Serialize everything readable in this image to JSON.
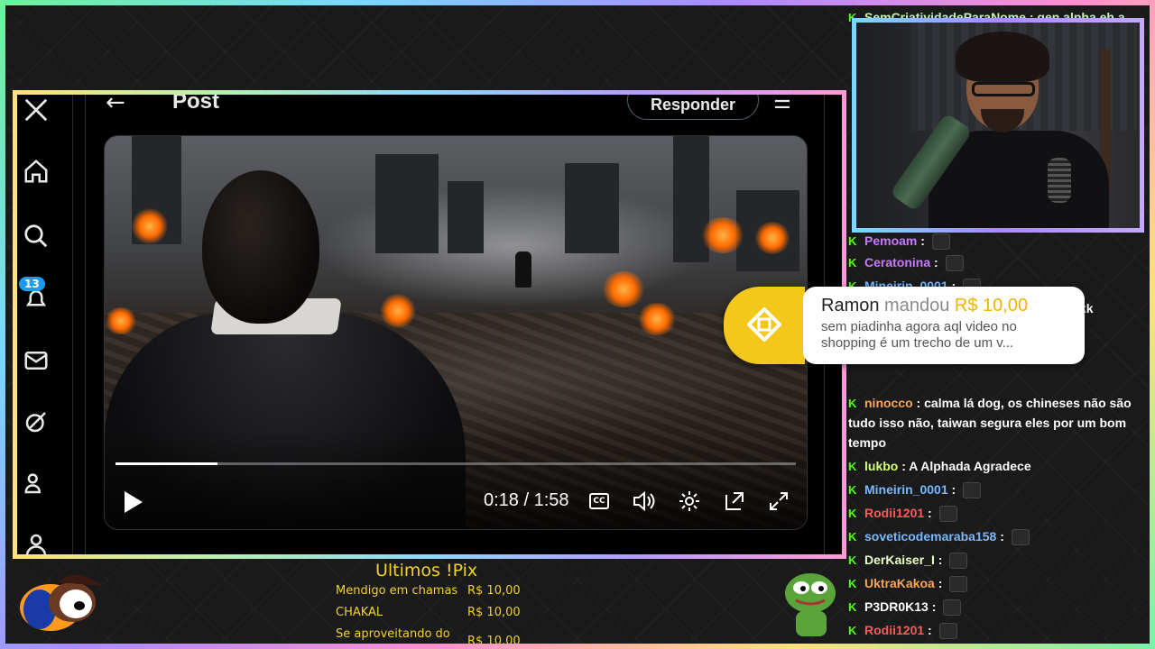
{
  "post_view": {
    "title": "Post",
    "reply_label": "Responder",
    "notification_count": "13"
  },
  "video": {
    "time": "0:18 / 1:58",
    "progress": 0.15,
    "cc_label": "CC"
  },
  "donation": {
    "name": "Ramon",
    "verb": "mandou",
    "amount": "R$ 10,00",
    "message": "sem piadinha agora aql video no shopping é um trecho de um v..."
  },
  "chat": {
    "top_line": "SemCriatividadeParaNome : gen alpha eh a",
    "partial_line": "Mineirin_0001",
    "messages": [
      {
        "user": "Pemoam",
        "color": "#c879ff",
        "text": "",
        "emote": true
      },
      {
        "user": "Ceratonina",
        "color": "#c879ff",
        "text": "",
        "emote": true
      },
      {
        "user": "Mineirin_0001",
        "color": "#79b8ff",
        "text": "",
        "emote": true
      },
      {
        "user": "ninocco",
        "color": "#f5a65b",
        "text": "calma lá dog, os chineses não são tudo isso não, taiwan segura eles por um bom tempo",
        "emote": false
      },
      {
        "user": "lukbo",
        "color": "#d5ff7a",
        "text": "A Alphada Agradece",
        "emote": false
      },
      {
        "user": "Mineirin_0001",
        "color": "#79b8ff",
        "text": "",
        "emote": true
      },
      {
        "user": "Rodii1201",
        "color": "#ff5a5a",
        "text": "",
        "emote": true
      },
      {
        "user": "soveticodemaraba158",
        "color": "#79b8ff",
        "text": "",
        "emote": true
      },
      {
        "user": "DerKaiser_I",
        "color": "#eaffc8",
        "text": "",
        "emote": true
      },
      {
        "user": "UktraKakoa",
        "color": "#f5a65b",
        "text": "",
        "emote": true
      },
      {
        "user": "P3DR0K13",
        "color": "#ffffff",
        "text": "",
        "emote": true
      },
      {
        "user": "Rodii1201",
        "color": "#ff5a5a",
        "text": "",
        "emote": true
      }
    ],
    "overflow_text": "kk"
  },
  "pix": {
    "title": "Ultimos !Pix",
    "rows": [
      {
        "name": "Mendigo em chamas",
        "value": "R$ 10,00"
      },
      {
        "name": "CHAKAL",
        "value": "R$ 10,00"
      },
      {
        "name": "Se aproveitando do",
        "value": "R$ 10,00"
      }
    ]
  }
}
